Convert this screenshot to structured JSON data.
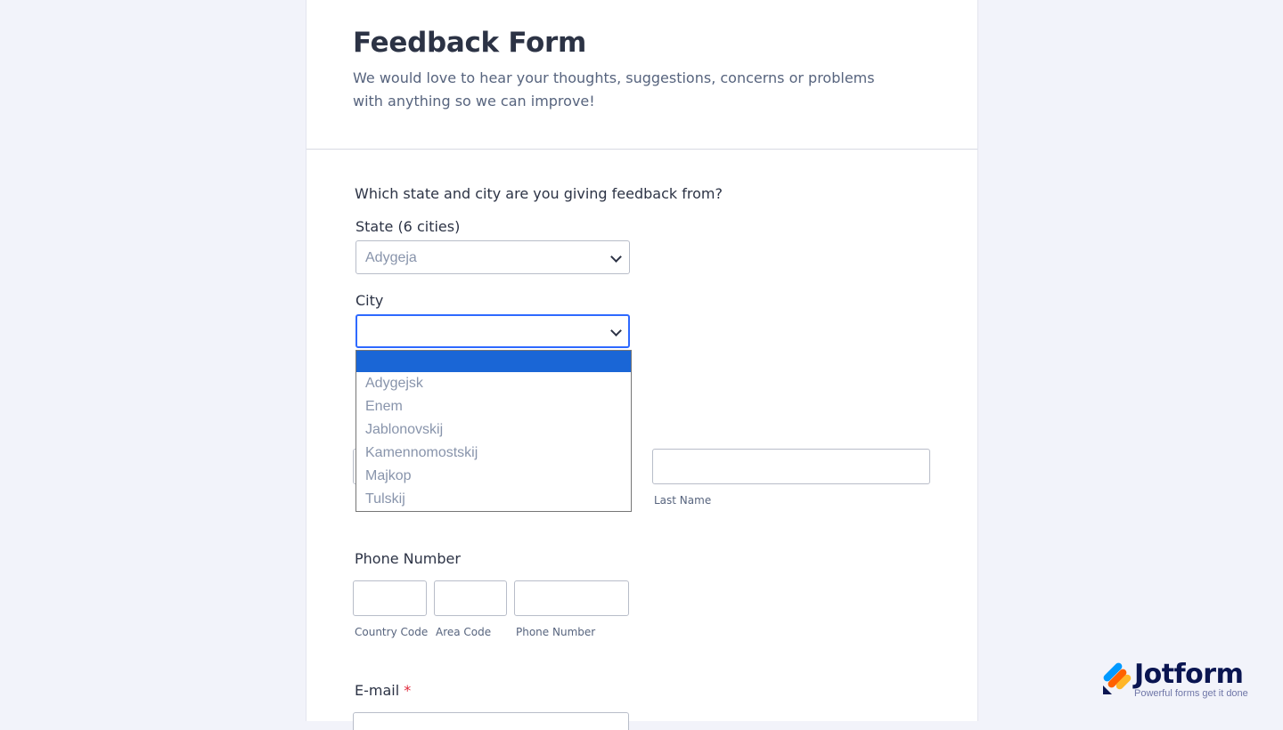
{
  "form": {
    "title": "Feedback Form",
    "subtitle": "We would love to hear your thoughts, suggestions, concerns or problems with anything so we can improve!"
  },
  "location": {
    "question": "Which state and city are you giving feedback from?",
    "state_label": "State (6 cities)",
    "state_value": "Adygeja",
    "city_label": "City",
    "city_value": "",
    "city_options": [
      "",
      "Adygejsk",
      "Enem",
      "Jablonovskij",
      "Kamennomostskij",
      "Majkop",
      "Tulskij"
    ]
  },
  "name": {
    "first_value": "",
    "last_value": "",
    "last_sublabel": "Last Name"
  },
  "phone": {
    "label": "Phone Number",
    "country_sublabel": "Country Code",
    "area_sublabel": "Area Code",
    "number_sublabel": "Phone Number"
  },
  "email": {
    "label": "E-mail",
    "required_mark": "*"
  },
  "branding": {
    "name": "Jotform",
    "tagline": "Powerful forms get it done"
  },
  "colors": {
    "accent": "#2e69ff",
    "highlight": "#1a66d6",
    "required": "#e0293b"
  }
}
